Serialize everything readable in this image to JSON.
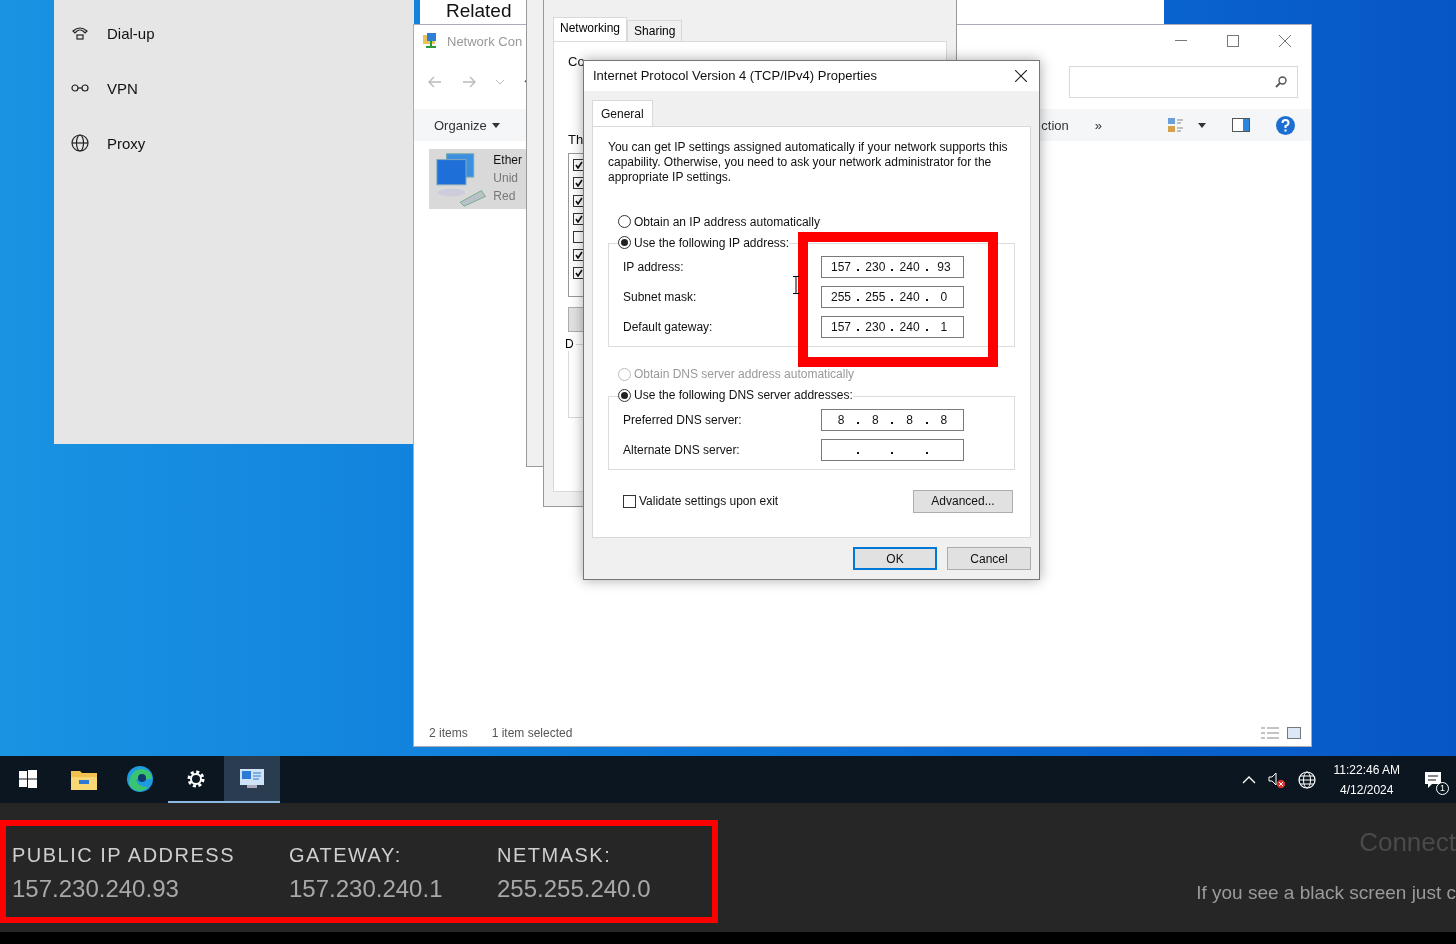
{
  "settings_panel": {
    "items": [
      {
        "label": "Dial-up",
        "kind": "dialup"
      },
      {
        "label": "VPN",
        "kind": "vpn"
      },
      {
        "label": "Proxy",
        "kind": "proxy"
      }
    ]
  },
  "background_window": {
    "heading": "Related"
  },
  "explorer": {
    "title": "Network Con",
    "toolbar": {
      "organize": "Organize",
      "item_2": "ction",
      "more": "»"
    },
    "items": [
      {
        "name": "Ether",
        "status": "Unid",
        "device": "Red",
        "selected": true
      }
    ],
    "status_bar": [
      "2 items",
      "1 item selected"
    ]
  },
  "ethernet_properties": {
    "tabs": [
      {
        "label": "Networking",
        "selected": true
      },
      {
        "label": "Sharing",
        "selected": false
      }
    ],
    "connect_label": "Co",
    "list_label": "Th",
    "group_label": "D",
    "components": [
      {
        "checked": true
      },
      {
        "checked": true
      },
      {
        "checked": true
      },
      {
        "checked": true
      },
      {
        "checked": false
      },
      {
        "checked": true
      },
      {
        "checked": true
      }
    ]
  },
  "ipv4_dialog": {
    "title": "Internet Protocol Version 4 (TCP/IPv4) Properties",
    "tabs": [
      {
        "label": "General",
        "selected": true
      }
    ],
    "description": "You can get IP settings assigned automatically if your network supports this capability. Otherwise, you need to ask your network administrator for the appropriate IP settings.",
    "ip_options": [
      {
        "label": "Obtain an IP address automatically",
        "selected": false,
        "disabled": false
      },
      {
        "label": "Use the following IP address:",
        "selected": true,
        "disabled": false
      }
    ],
    "ip_fields": [
      {
        "label": "IP address:",
        "octets": [
          "157",
          "230",
          "240",
          "93"
        ]
      },
      {
        "label": "Subnet mask:",
        "octets": [
          "255",
          "255",
          "240",
          "0"
        ]
      },
      {
        "label": "Default gateway:",
        "octets": [
          "157",
          "230",
          "240",
          "1"
        ]
      }
    ],
    "dns_options": [
      {
        "label": "Obtain DNS server address automatically",
        "selected": false,
        "disabled": true
      },
      {
        "label": "Use the following DNS server addresses:",
        "selected": true,
        "disabled": false
      }
    ],
    "dns_fields": [
      {
        "label": "Preferred DNS server:",
        "octets": [
          "8",
          "8",
          "8",
          "8"
        ]
      },
      {
        "label": "Alternate DNS server:"
      }
    ],
    "validate": {
      "label": "Validate settings upon exit",
      "checked": false
    },
    "advanced_button": "Advanced...",
    "buttons": [
      {
        "label": "OK",
        "default": true
      },
      {
        "label": "Cancel",
        "default": false
      }
    ]
  },
  "taskbar": {
    "apps": [
      {
        "kind": "start",
        "running": false,
        "selected": false
      },
      {
        "kind": "folder",
        "running": false,
        "selected": false
      },
      {
        "kind": "browser",
        "running": false,
        "selected": false
      },
      {
        "kind": "gear",
        "running": true,
        "selected": false
      },
      {
        "kind": "control-panel",
        "running": true,
        "selected": true
      }
    ],
    "time": "11:22:46 AM",
    "date": "4/12/2024",
    "notifications": "1"
  },
  "connection_panel": {
    "stats": [
      {
        "label": "PUBLIC IP ADDRESS",
        "value": "157.230.240.93"
      },
      {
        "label": "GATEWAY:",
        "value": "157.230.240.1"
      },
      {
        "label": "NETMASK:",
        "value": "255.255.240.0"
      }
    ],
    "status": "Connect",
    "hint": "If you see a black screen just c"
  }
}
